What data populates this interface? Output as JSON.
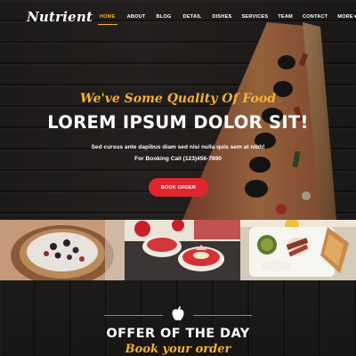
{
  "brand": {
    "logo": "Nutrient"
  },
  "nav": {
    "items": [
      {
        "label": "HOME",
        "active": true
      },
      {
        "label": "ABOUT",
        "active": false
      },
      {
        "label": "BLOG",
        "active": false
      },
      {
        "label": "DETAIL",
        "active": false
      },
      {
        "label": "DISHES",
        "active": false
      },
      {
        "label": "SERVICES",
        "active": false
      },
      {
        "label": "TEAM",
        "active": false
      },
      {
        "label": "CONTACT",
        "active": false
      },
      {
        "label": "MORE",
        "active": false
      }
    ],
    "more_icon": "chevron-down-icon"
  },
  "hero": {
    "tagline": "We've Some Quality Of Food",
    "headline": "LOREM IPSUM DOLOR SIT!",
    "subtext": "Sed cursus ante dapibus diam sed nisi nulla quis sem at nibh!",
    "booking": "For Booking Call (123)456-7890",
    "cta_label": "BOOK ORDER"
  },
  "gallery": {
    "photos": [
      "dessert-tart-photo",
      "strawberry-dessert-photo",
      "breakfast-plate-photo"
    ]
  },
  "offer": {
    "icon": "apple-icon",
    "title": "OFFER OF THE DAY",
    "subtitle": "Book your order"
  },
  "colors": {
    "accent": "#f6b233",
    "cta": "#e0262e",
    "background": "#1a1716",
    "text": "#ffffff"
  }
}
